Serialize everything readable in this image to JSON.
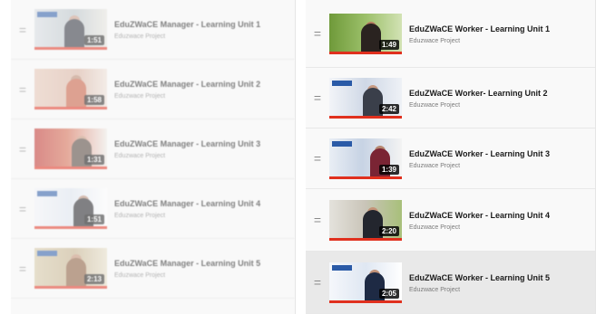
{
  "left_playlist": {
    "items": [
      {
        "title": "EduZWaCE Manager - Learning Unit 1",
        "channel": "Eduzwace Project",
        "duration": "1:51"
      },
      {
        "title": "EduZWaCE Manager - Learning Unit 2",
        "channel": "Eduzwace Project",
        "duration": "1:58"
      },
      {
        "title": "EduZWaCE Manager - Learning Unit 3",
        "channel": "Eduzwace Project",
        "duration": "1:31"
      },
      {
        "title": "EduZWaCE Manager - Learning Unit 4",
        "channel": "Eduzwace Project",
        "duration": "1:51"
      },
      {
        "title": "EduZWaCE Manager - Learning Unit 5",
        "channel": "Eduzwace Project",
        "duration": "2:13"
      }
    ]
  },
  "right_playlist": {
    "items": [
      {
        "title": "EduZWaCE Worker - Learning Unit 1",
        "channel": "Eduzwace Project",
        "duration": "1:49"
      },
      {
        "title": "EduZWaCE Worker- Learning Unit 2",
        "channel": "Eduzwace Project",
        "duration": "2:42"
      },
      {
        "title": "EduZWaCE Worker - Learning Unit 3",
        "channel": "Eduzwace Project",
        "duration": "1:39"
      },
      {
        "title": "EduZWaCE Worker - Learning Unit 4",
        "channel": "Eduzwace Project",
        "duration": "2:20"
      },
      {
        "title": "EduZWaCE Worker - Learning Unit 5",
        "channel": "Eduzwace Project",
        "duration": "2:05"
      }
    ]
  },
  "icons": {
    "drag_handle": "drag-handle-icon",
    "glyph": "="
  },
  "colors": {
    "progress_bar": "#e0301e",
    "duration_badge": "#000000",
    "active_row": "#e9e9e9"
  }
}
